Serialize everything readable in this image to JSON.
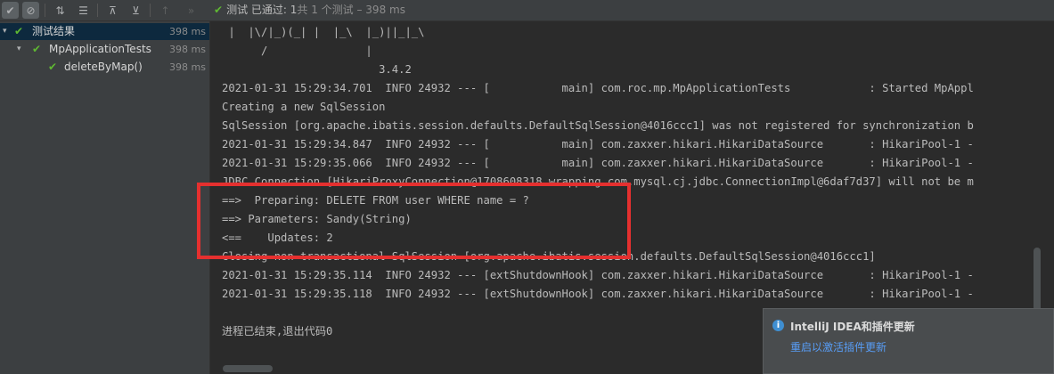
{
  "toolbar": {
    "status_prefix": "测试",
    "status_passed": "已通过: 1",
    "status_rest": "共 1 个测试 – 398 ms"
  },
  "tree": [
    {
      "label": "测试结果",
      "time": "398 ms"
    },
    {
      "label": "MpApplicationTests",
      "time": "398 ms"
    },
    {
      "label": "deleteByMap()",
      "time": "398 ms"
    }
  ],
  "console": {
    "lines": [
      " |  |\\/|_)(_| |  |_\\  |_)||_|_\\",
      "      /               |",
      "                        3.4.2",
      "2021-01-31 15:29:34.701  INFO 24932 --- [           main] com.roc.mp.MpApplicationTests            : Started MpAppl",
      "Creating a new SqlSession",
      "SqlSession [org.apache.ibatis.session.defaults.DefaultSqlSession@4016ccc1] was not registered for synchronization b",
      "2021-01-31 15:29:34.847  INFO 24932 --- [           main] com.zaxxer.hikari.HikariDataSource       : HikariPool-1 -",
      "2021-01-31 15:29:35.066  INFO 24932 --- [           main] com.zaxxer.hikari.HikariDataSource       : HikariPool-1 -",
      "JDBC Connection [HikariProxyConnection@1708608318 wrapping com.mysql.cj.jdbc.ConnectionImpl@6daf7d37] will not be m",
      "==>  Preparing: DELETE FROM user WHERE name = ?",
      "==> Parameters: Sandy(String)",
      "<==    Updates: 2",
      "Closing non transactional SqlSession [org.apache.ibatis.session.defaults.DefaultSqlSession@4016ccc1]",
      "2021-01-31 15:29:35.114  INFO 24932 --- [extShutdownHook] com.zaxxer.hikari.HikariDataSource       : HikariPool-1 -",
      "2021-01-31 15:29:35.118  INFO 24932 --- [extShutdownHook] com.zaxxer.hikari.HikariDataSource       : HikariPool-1 -",
      "",
      "进程已结束,退出代码0"
    ]
  },
  "notification": {
    "title": "IntelliJ IDEA和插件更新",
    "link": "重启以激活插件更新"
  }
}
